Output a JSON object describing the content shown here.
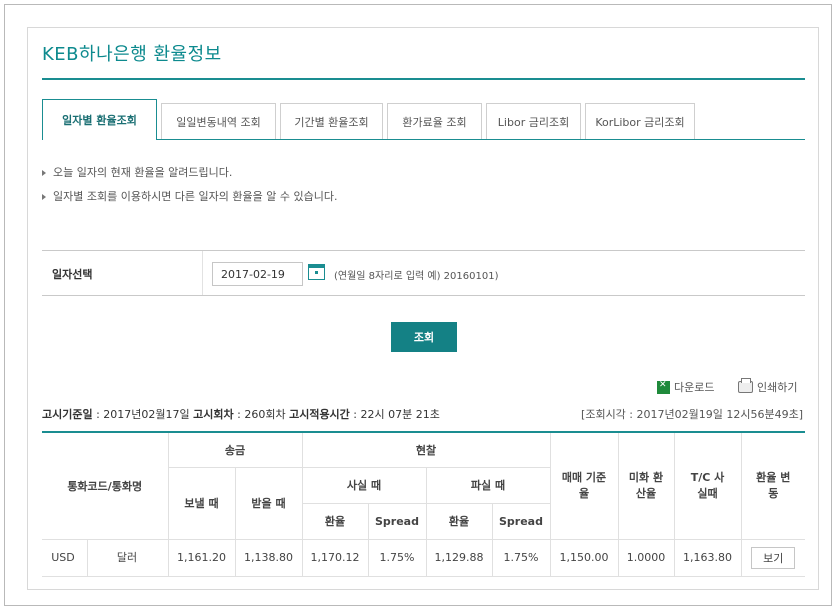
{
  "page": {
    "title": "KEB하나은행 환율정보"
  },
  "tabs": [
    {
      "label": "일자별 환율조회",
      "active": true
    },
    {
      "label": "일일변동내역 조회",
      "active": false
    },
    {
      "label": "기간별 환율조회",
      "active": false
    },
    {
      "label": "환가료율 조회",
      "active": false
    },
    {
      "label": "Libor 금리조회",
      "active": false
    },
    {
      "label": "KorLibor 금리조회",
      "active": false
    }
  ],
  "notices": [
    "오늘 일자의 현재 환율을 알려드립니다.",
    "일자별 조회를 이용하시면 다른 일자의 환율을 알 수 있습니다."
  ],
  "date_select": {
    "label": "일자선택",
    "value": "2017-02-19",
    "hint": "(연월일 8자리로 입력 예) 20160101)"
  },
  "search_button": "조회",
  "actions": {
    "download": "다운로드",
    "print": "인쇄하기"
  },
  "meta": {
    "base_date_label": "고시기준일",
    "base_date_value": " : 2017년02월17일 ",
    "round_label": "고시회차",
    "round_value": " : 260회차 ",
    "apply_time_label": "고시적용시간",
    "apply_time_value": " : 22시 07분 21초",
    "query_time": "[조회시각 : 2017년02월19일 12시56분49초]"
  },
  "table": {
    "headers": {
      "currency": "통화코드/통화명",
      "remit": "송금",
      "cash": "현찰",
      "remit_send": "보낼 때",
      "remit_receive": "받을 때",
      "cash_buy": "사실 때",
      "cash_sell": "파실 때",
      "rate": "환율",
      "spread": "Spread",
      "base_rate": "매매 기준율",
      "usd_rate": "미화 환산율",
      "tc_buy": "T/C 사실때",
      "change": "환율 변동"
    },
    "rows": [
      {
        "code": "USD",
        "name": "달러",
        "remit_send": "1,161.20",
        "remit_receive": "1,138.80",
        "cash_buy_rate": "1,170.12",
        "cash_buy_spread": "1.75%",
        "cash_sell_rate": "1,129.88",
        "cash_sell_spread": "1.75%",
        "base_rate": "1,150.00",
        "usd_rate": "1.0000",
        "tc_buy": "1,163.80",
        "view_label": "보기"
      }
    ]
  }
}
